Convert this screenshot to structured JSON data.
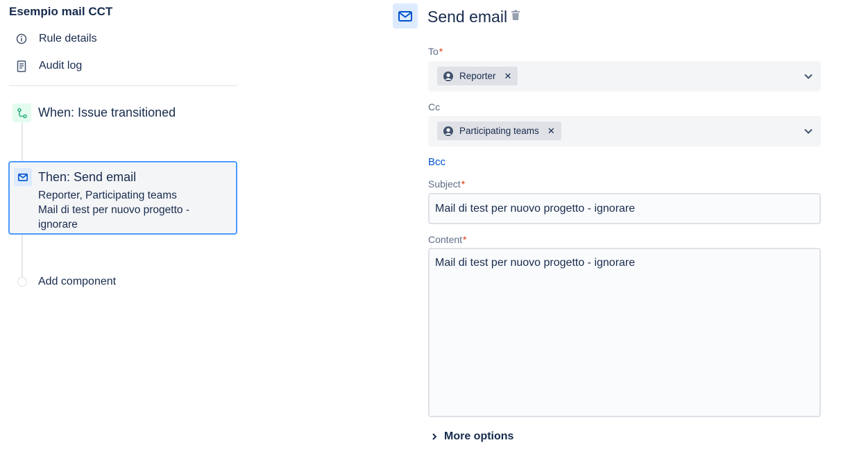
{
  "sidebar": {
    "rule_title": "Esempio mail CCT",
    "nav": [
      {
        "label": "Rule details",
        "icon": "info-icon"
      },
      {
        "label": "Audit log",
        "icon": "document-icon"
      }
    ],
    "trigger": {
      "label": "When: Issue transitioned",
      "icon": "transition-icon",
      "color": "#36b37e"
    },
    "action": {
      "title": "Then: Send email",
      "recipients": "Reporter, Participating teams",
      "subject_line1": "Mail di test per nuovo progetto -",
      "subject_line2": "ignorare",
      "icon": "mail-icon"
    },
    "add_component": "Add component"
  },
  "panel": {
    "title": "Send email",
    "icon": "mail-icon",
    "to_label": "To",
    "to_chip": "Reporter",
    "cc_label": "Cc",
    "cc_chip": "Participating teams",
    "required_mark": "*",
    "bcc_link": "Bcc",
    "subject_label": "Subject",
    "subject_value": "Mail di test per nuovo progetto - ignorare",
    "content_label": "Content",
    "content_value": "Mail di test per nuovo progetto - ignorare",
    "more_options": "More options"
  },
  "colors": {
    "accent": "#0052cc",
    "selected_border": "#4c9aff",
    "required": "#de350b",
    "trigger_green": "#36b37e"
  }
}
